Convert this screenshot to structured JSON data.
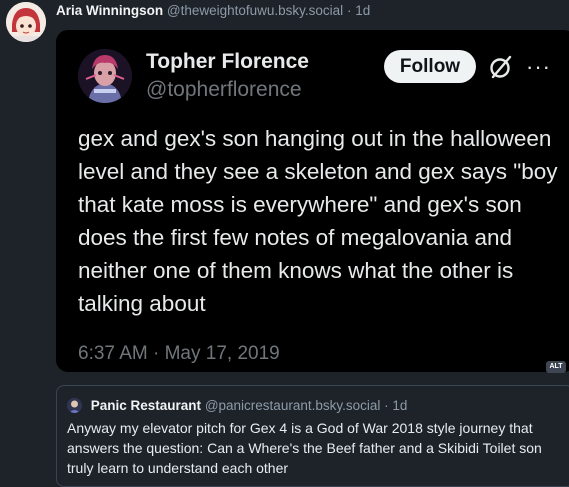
{
  "post": {
    "author_name": "Aria Winningson",
    "author_handle": "@theweightofuwu.bsky.social",
    "separator": "·",
    "time": "1d"
  },
  "embed": {
    "name": "Topher Florence",
    "handle": "@topherflorence",
    "follow_label": "Follow",
    "more_label": "···",
    "text": "gex and gex's son hanging out in the halloween level and they see a skeleton and gex says \"boy that kate moss is everywhere\" and gex's son does the first few notes of megalovania and neither one of them knows what the other is talking about",
    "date": "6:37 AM · May 17, 2019",
    "alt_label": "ALT"
  },
  "quote": {
    "name": "Panic Restaurant",
    "handle": "@panicrestaurant.bsky.social",
    "separator": "·",
    "time": "1d",
    "text": "Anyway my elevator pitch for Gex 4 is a God of War 2018 style journey that answers the question: Can a Where's the Beef father and a Skibidi Toilet son truly learn to understand each other"
  }
}
